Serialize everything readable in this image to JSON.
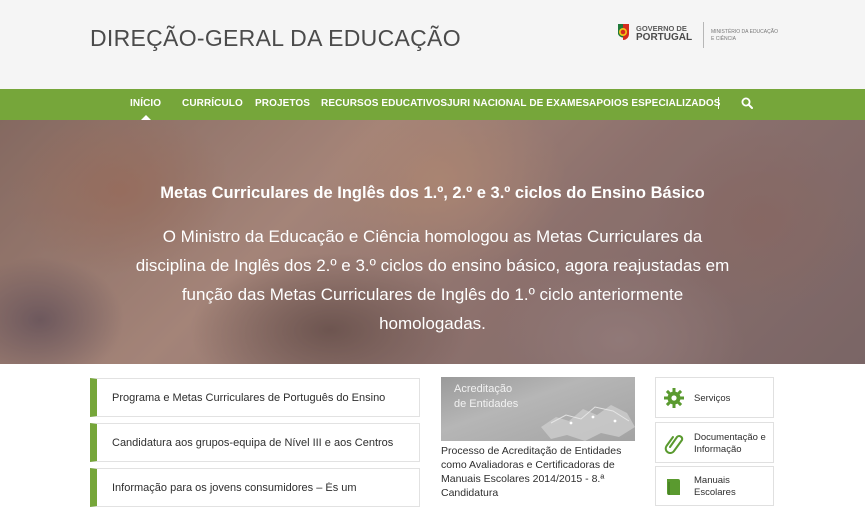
{
  "header": {
    "site_title": "DIREÇÃO-GERAL DA EDUCAÇÃO",
    "gov_line1": "GOVERNO DE",
    "gov_line2": "PORTUGAL",
    "ministry": "MINISTÉRIO DA EDUCAÇÃO E CIÊNCIA"
  },
  "nav": {
    "items": [
      {
        "label": "INÍCIO"
      },
      {
        "label": "CURRÍCULO"
      },
      {
        "label": "PROJETOS"
      },
      {
        "label": "RECURSOS EDUCATIVOS"
      },
      {
        "label": "JURI NACIONAL DE EXAMES"
      },
      {
        "label": "APOIOS ESPECIALIZADOS"
      }
    ],
    "active_index": 0
  },
  "hero": {
    "title": "Metas Curriculares de Inglês dos 1.º, 2.º e 3.º ciclos do Ensino Básico",
    "text": "O Ministro da Educação e Ciência homologou as Metas Curriculares da disciplina de Inglês dos 2.º e 3.º ciclos do ensino básico, agora reajustadas em função das Metas Curriculares de Inglês do 1.º ciclo anteriormente homologadas."
  },
  "news": [
    {
      "text": "Programa e Metas Curriculares de Português do Ensino"
    },
    {
      "text": "Candidatura aos grupos-equipa de Nível III e aos Centros"
    },
    {
      "text": "Informação para os jovens consumidores – És um"
    }
  ],
  "feature": {
    "image_label_line1": "Acreditação",
    "image_label_line2": "de Entidades",
    "caption": "Processo de Acreditação de Entidades como Avaliadoras e Certificadoras de Manuais Escolares 2014/2015 - 8.ª Candidatura"
  },
  "side_links": [
    {
      "label": "Serviços",
      "icon": "gear-icon"
    },
    {
      "label": "Documentação e Informação",
      "icon": "paperclip-icon"
    },
    {
      "label": "Manuais Escolares",
      "icon": "book-icon"
    }
  ],
  "colors": {
    "accent": "#76a63a",
    "header_bg": "#f5f5f5",
    "text": "#2e2e2e"
  }
}
